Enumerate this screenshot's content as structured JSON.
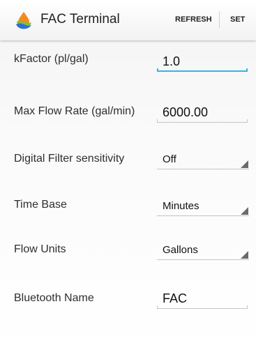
{
  "header": {
    "title": "FAC Terminal",
    "refresh_label": "REFRESH",
    "set_label": "SET",
    "icon": "fac-droplet-logo-icon"
  },
  "fields": [
    {
      "label": "kFactor (pl/gal)",
      "value": "1.0",
      "type": "text",
      "focused": true
    },
    {
      "label": "Max Flow Rate (gal/min)",
      "value": "6000.00",
      "type": "text"
    },
    {
      "label": "Digital Filter sensitivity",
      "value": "Off",
      "type": "dropdown"
    },
    {
      "label": "Time Base",
      "value": "Minutes",
      "type": "dropdown"
    },
    {
      "label": "Flow Units",
      "value": "Gallons",
      "type": "dropdown"
    },
    {
      "label": "Bluetooth Name",
      "value": "FAC",
      "type": "text"
    }
  ],
  "colors": {
    "focus_accent": "#33b5e5",
    "logo_blue": "#2f6fcf",
    "logo_orange": "#f28c1e",
    "logo_green": "#7cc242"
  }
}
